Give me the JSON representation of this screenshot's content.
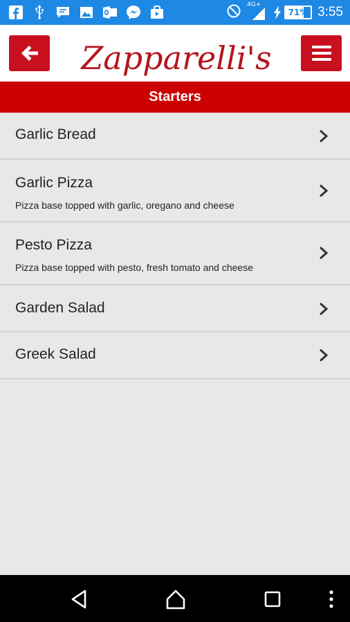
{
  "status_bar": {
    "icons": [
      "facebook-icon",
      "usb-icon",
      "chat-icon",
      "image-icon",
      "outlook-icon",
      "messenger-icon",
      "store-icon"
    ],
    "network": "4G+",
    "battery": "71%",
    "battery_level": 0.71,
    "time": "3:55"
  },
  "header": {
    "logo_text": "Zapparelli's",
    "back_icon": "arrow-left-icon",
    "menu_icon": "hamburger-menu-icon",
    "accent_color": "#c8101f"
  },
  "section": {
    "title": "Starters",
    "color": "#cc0000"
  },
  "menu_items": [
    {
      "title": "Garlic Bread",
      "description": ""
    },
    {
      "title": "Garlic Pizza",
      "description": "Pizza base topped with garlic, oregano and cheese"
    },
    {
      "title": "Pesto Pizza",
      "description": "Pizza base topped with pesto, fresh tomato and cheese"
    },
    {
      "title": "Garden Salad",
      "description": ""
    },
    {
      "title": "Greek Salad",
      "description": ""
    }
  ],
  "nav_bar": {
    "icons": [
      "back-triangle-icon",
      "home-icon",
      "recents-icon",
      "more-vert-icon"
    ]
  }
}
